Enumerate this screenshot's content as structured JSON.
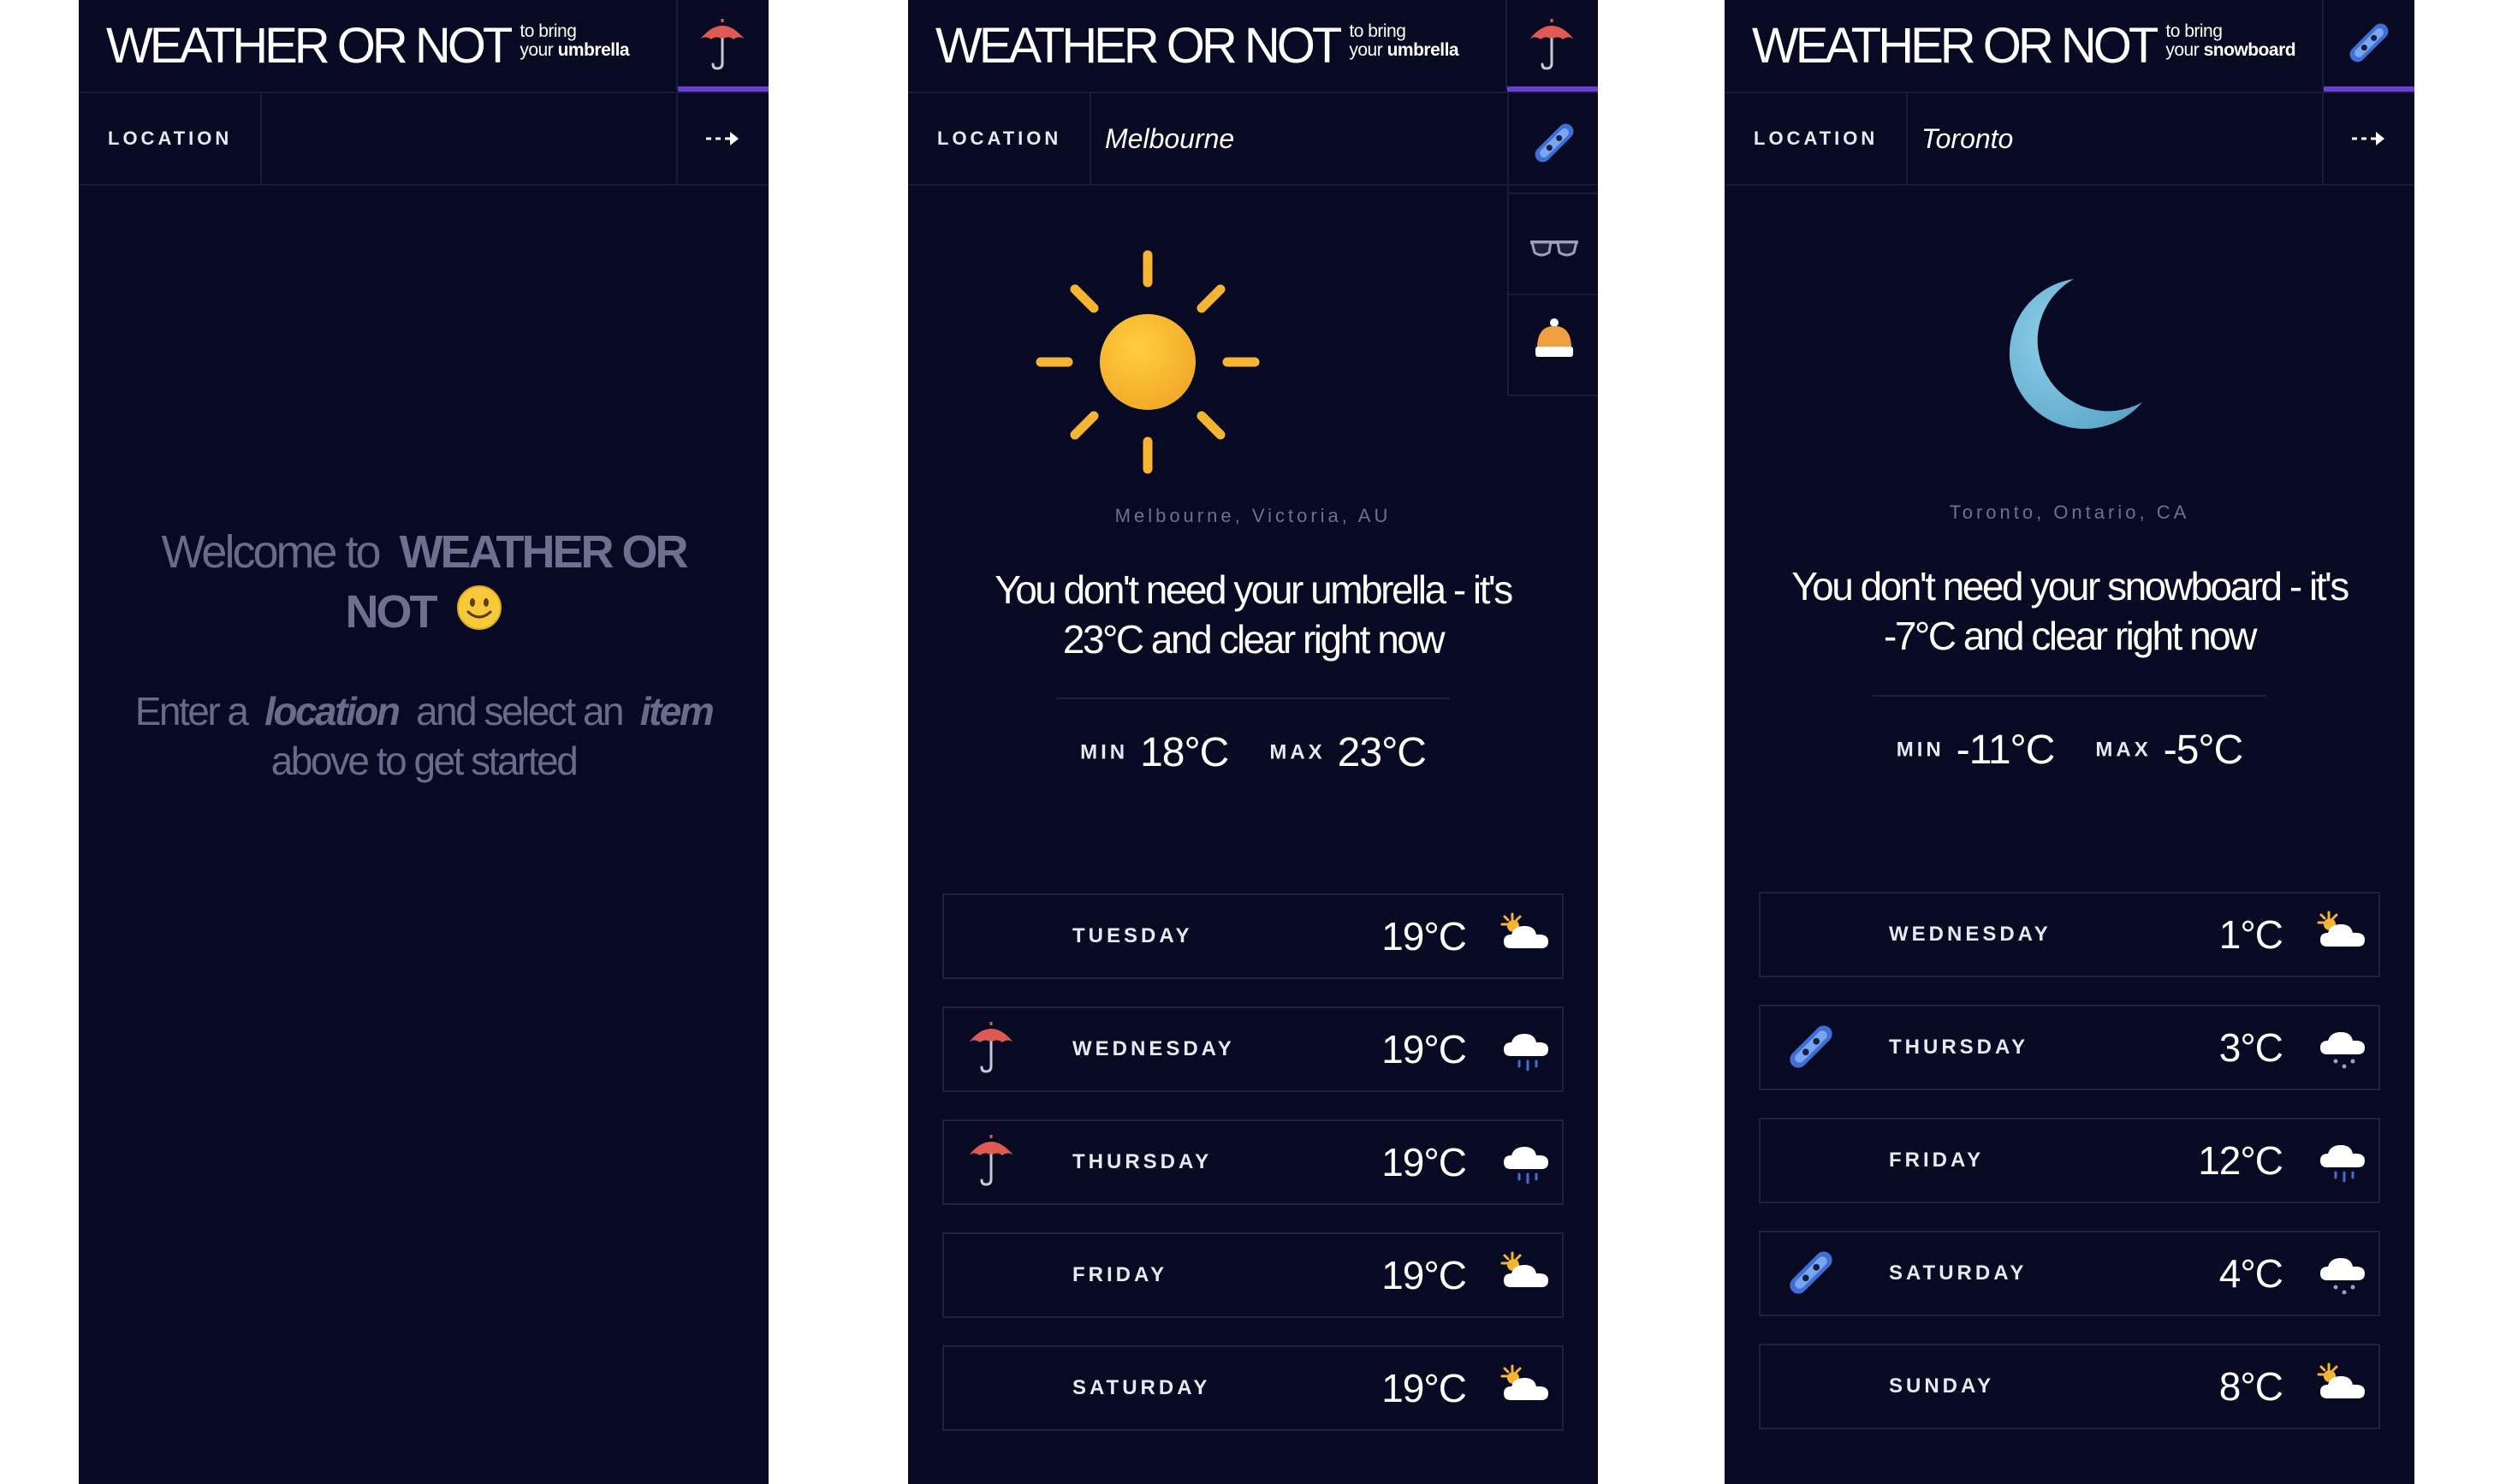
{
  "brand": {
    "title": "WEATHER OR NOT",
    "sub_prefix": "to bring",
    "sub_your": "your"
  },
  "location_label": "LOCATION",
  "screens": [
    {
      "item": "umbrella",
      "location_value": "",
      "location_placeholder": "",
      "welcome": {
        "title_prefix": "Welcome to",
        "title_brand": "WEATHER OR NOT",
        "sub_1": "Enter a",
        "sub_location": "location",
        "sub_2": "and select an",
        "sub_item": "item",
        "sub_3": "above to get started"
      }
    },
    {
      "item": "umbrella",
      "location_value": "Melbourne",
      "side_menu": [
        "snowboard-icon",
        "sunglasses-icon",
        "beanie-icon"
      ],
      "current_icon": "sun-icon",
      "place": "Melbourne, Victoria, AU",
      "verdict": "You don't need your umbrella - it's 23°C and clear right now",
      "min_label": "MIN",
      "min": "18°C",
      "max_label": "MAX",
      "max": "23°C",
      "forecast": [
        {
          "day": "TUESDAY",
          "temp": "19°C",
          "item": false,
          "icon": "partly-cloudy-icon"
        },
        {
          "day": "WEDNESDAY",
          "temp": "19°C",
          "item": true,
          "icon": "rain-cloud-icon"
        },
        {
          "day": "THURSDAY",
          "temp": "19°C",
          "item": true,
          "icon": "rain-cloud-icon"
        },
        {
          "day": "FRIDAY",
          "temp": "19°C",
          "item": false,
          "icon": "partly-cloudy-icon"
        },
        {
          "day": "SATURDAY",
          "temp": "19°C",
          "item": false,
          "icon": "partly-cloudy-icon"
        }
      ]
    },
    {
      "item": "snowboard",
      "location_value": "Toronto",
      "current_icon": "moon-icon",
      "place": "Toronto, Ontario, CA",
      "verdict": "You don't need your snowboard - it's -7°C and clear right now",
      "min_label": "MIN",
      "min": "-11°C",
      "max_label": "MAX",
      "max": "-5°C",
      "forecast": [
        {
          "day": "WEDNESDAY",
          "temp": "1°C",
          "item": false,
          "icon": "partly-cloudy-icon"
        },
        {
          "day": "THURSDAY",
          "temp": "3°C",
          "item": true,
          "icon": "snow-cloud-icon"
        },
        {
          "day": "FRIDAY",
          "temp": "12°C",
          "item": false,
          "icon": "rain-cloud-icon"
        },
        {
          "day": "SATURDAY",
          "temp": "4°C",
          "item": true,
          "icon": "snow-cloud-icon"
        },
        {
          "day": "SUNDAY",
          "temp": "8°C",
          "item": false,
          "icon": "partly-cloudy-icon"
        }
      ]
    }
  ],
  "colors": {
    "background": "#070a22",
    "accent": "#6a3dd6",
    "muted_text": "#6c6a8a",
    "sun": "#f5b532",
    "moon": "#7ec1e0",
    "umbrella": "#e05a55",
    "snowboard": "#3f6fd6"
  }
}
